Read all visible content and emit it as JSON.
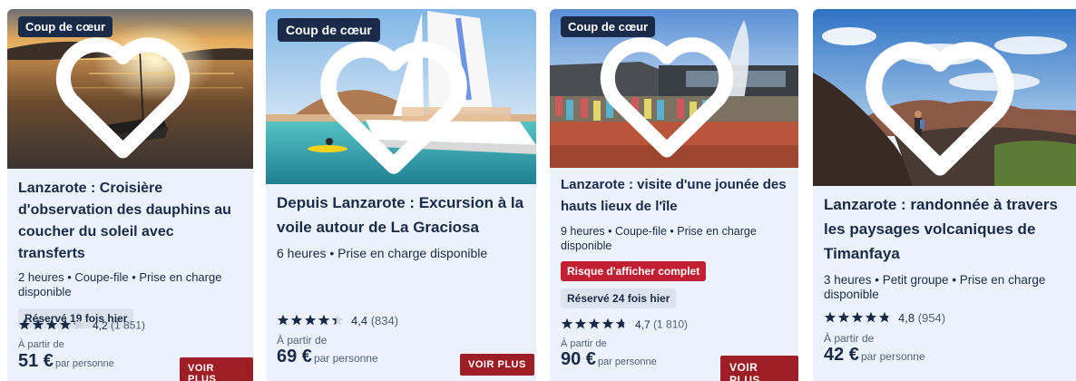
{
  "cards": [
    {
      "tag": "Coup de cœur",
      "title": "Lanzarote : Croisière d'observation des dauphins au coucher du soleil avec transferts",
      "meta": "2 heures • Coupe-file • Prise en charge disponible",
      "booked": "Réservé 19 fois hier",
      "rating_value": "4,2",
      "rating_count": "(1 851)",
      "rating_stars": 4.2,
      "from_label": "À partir de",
      "price": "51 €",
      "per": "par personne",
      "cta": "VOIR PLUS"
    },
    {
      "tag": "Coup de cœur",
      "title": "Depuis Lanzarote : Excursion à la voile autour de La Graciosa",
      "meta": "6 heures • Prise en charge disponible",
      "rating_value": "4,4",
      "rating_count": "(834)",
      "rating_stars": 4.4,
      "from_label": "À partir de",
      "price": "69 €",
      "per": "par personne",
      "cta": "VOIR PLUS"
    },
    {
      "tag": "Coup de cœur",
      "title": "Lanzarote : visite d'une jounée des hauts lieux de l'île",
      "meta": "9 heures • Coupe-file • Prise en charge disponible",
      "risk": "Risque d'afficher complet",
      "booked": "Réservé 24 fois hier",
      "rating_value": "4,7",
      "rating_count": "(1 810)",
      "rating_stars": 4.7,
      "from_label": "À partir de",
      "price": "90 €",
      "per": "par personne",
      "cta": "VOIR PLUS"
    },
    {
      "title": "Lanzarote : randonnée à travers les paysages volcaniques de Timanfaya",
      "meta": "3 heures • Petit groupe • Prise en charge disponible",
      "rating_value": "4,8",
      "rating_count": "(954)",
      "rating_stars": 4.8,
      "from_label": "À partir de",
      "price": "42 €",
      "per": "par personne"
    }
  ],
  "colors": {
    "navy": "#1a2b49",
    "card_bg": "#ebf2fb",
    "cta": "#9e1e26",
    "risk": "#c21f32"
  }
}
